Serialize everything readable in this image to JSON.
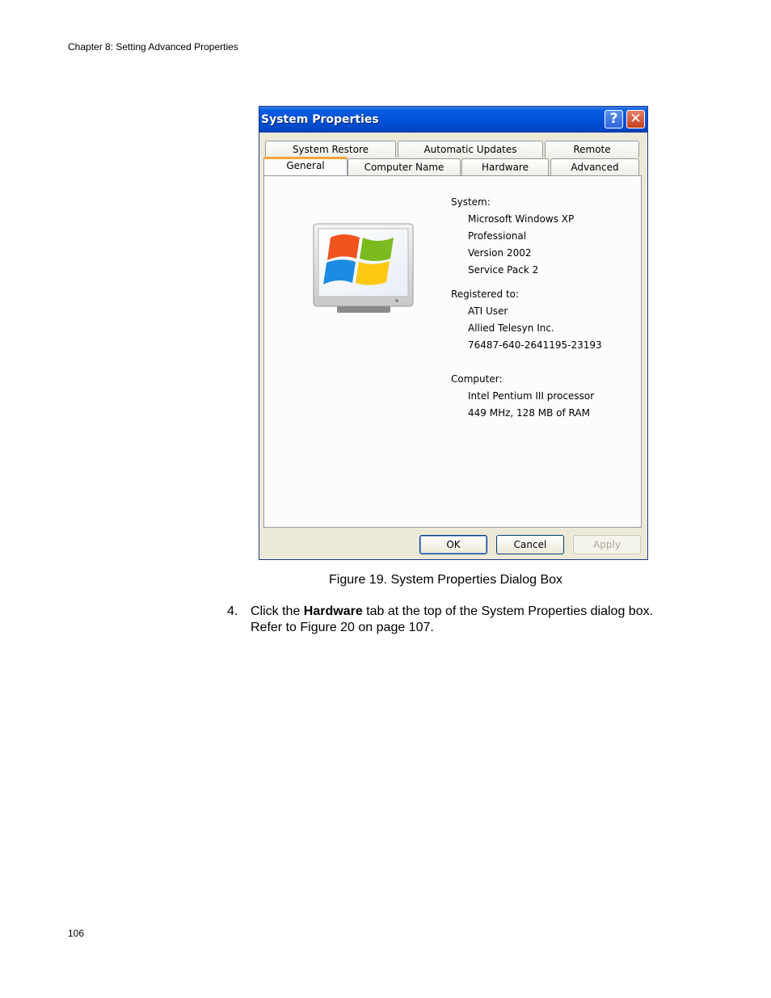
{
  "page": {
    "header": "Chapter 8: Setting Advanced Properties",
    "page_number": "106",
    "caption": "Figure 19. System Properties Dialog Box",
    "step": {
      "number": "4.",
      "pre": "Click the ",
      "bold": "Hardware",
      "post": " tab at the top of the System Properties dialog box.",
      "line2": "Refer to Figure 20 on page 107."
    }
  },
  "dialog": {
    "title": "System Properties",
    "help_glyph": "?",
    "close_glyph": "✕",
    "tabs_top": [
      "System Restore",
      "Automatic Updates",
      "Remote"
    ],
    "tabs_bottom": [
      "General",
      "Computer Name",
      "Hardware",
      "Advanced"
    ],
    "system": {
      "label": "System:",
      "lines": [
        "Microsoft Windows XP",
        "Professional",
        "Version 2002",
        "Service Pack 2"
      ]
    },
    "registered": {
      "label": "Registered to:",
      "lines": [
        "ATI User",
        "Allied Telesyn Inc.",
        "76487-640-2641195-23193"
      ]
    },
    "computer": {
      "label": "Computer:",
      "lines": [
        "Intel Pentium III processor",
        "449 MHz, 128 MB of RAM"
      ]
    },
    "buttons": {
      "ok": "OK",
      "cancel": "Cancel",
      "apply": "Apply"
    },
    "colors": {
      "titlebar": "#0052d9",
      "dialog_bg": "#ece9d8",
      "active_tab_accent": "#f4a53a"
    },
    "icons": [
      "windows-xp-logo-icon",
      "help-icon",
      "close-icon"
    ]
  }
}
